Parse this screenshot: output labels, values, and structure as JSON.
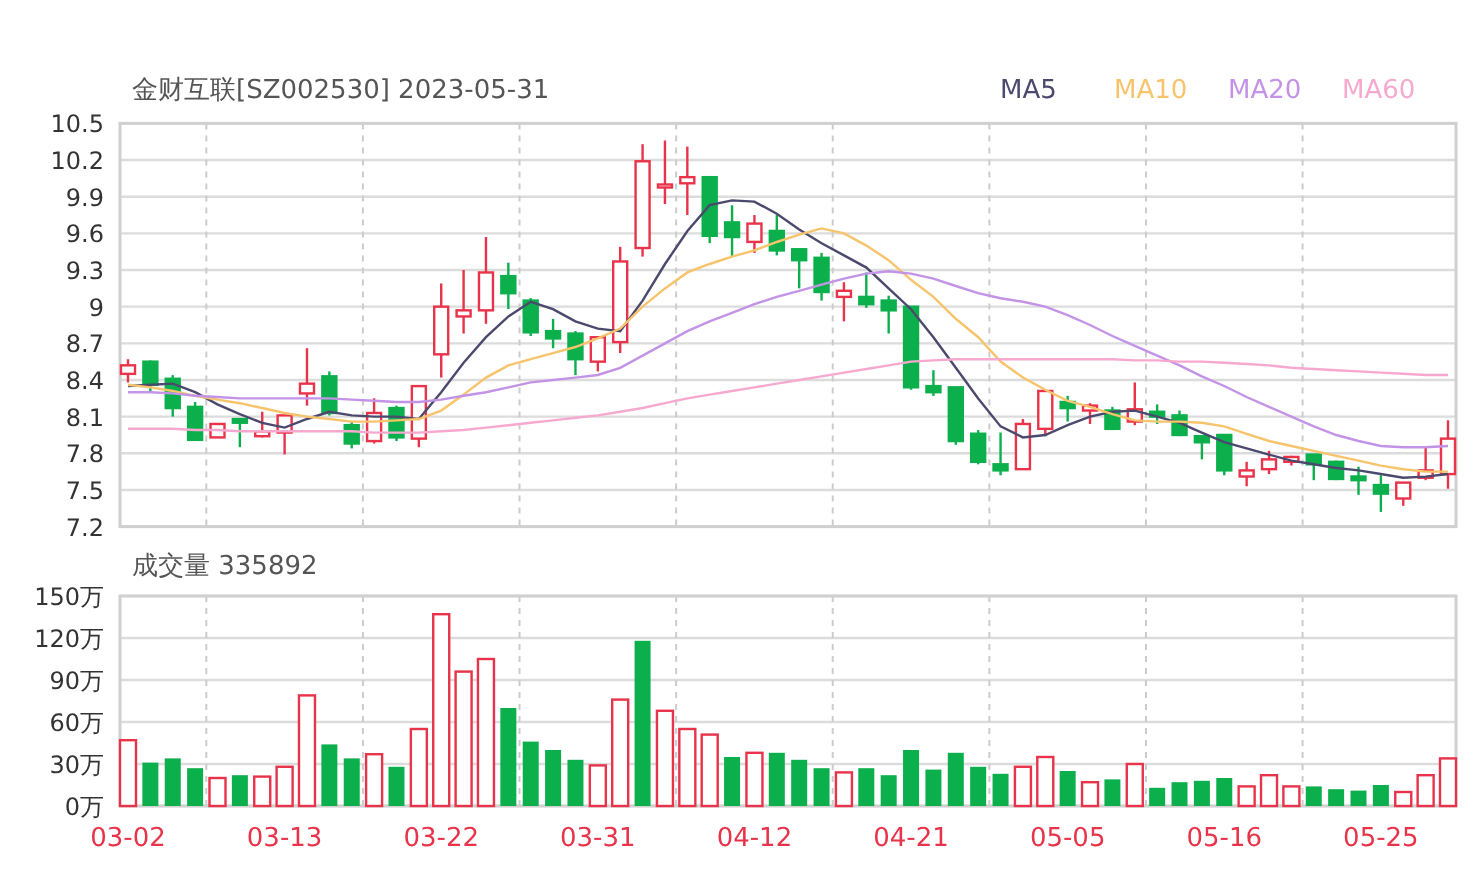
{
  "price_chart": {
    "chart_data": {
      "type": "candlestick",
      "title": "金财互联[SZ002530] 2023-05-31",
      "grid": true,
      "ylim": [
        7.2,
        10.5
      ],
      "yticks": [
        7.2,
        7.5,
        7.8,
        8.1,
        8.4,
        8.7,
        9,
        9.3,
        9.6,
        9.9,
        10.2,
        10.5
      ],
      "categories": [
        null,
        null,
        null,
        null,
        null,
        null,
        null,
        null,
        null,
        null,
        null,
        null,
        null,
        null,
        null,
        null,
        null,
        null,
        null,
        null,
        null,
        null,
        null,
        null,
        null,
        null,
        null,
        null,
        null,
        null,
        null,
        null,
        null,
        null,
        null,
        null,
        null,
        null,
        null,
        null,
        null,
        null,
        null,
        null,
        null,
        null,
        null,
        null,
        null,
        null,
        null,
        null,
        null,
        null,
        null,
        null,
        null,
        null,
        null,
        null
      ],
      "series": [
        {
          "name": "MA5",
          "type": "line",
          "color": "#4b4a6e",
          "values": [
            8.35,
            8.36,
            8.37,
            8.3,
            8.2,
            8.12,
            8.05,
            8.01,
            8.08,
            8.14,
            8.11,
            8.1,
            8.1,
            8.08,
            8.3,
            8.54,
            8.75,
            8.92,
            9.04,
            8.98,
            8.88,
            8.82,
            8.8,
            9.05,
            9.35,
            9.62,
            9.83,
            9.87,
            9.86,
            9.76,
            9.63,
            9.52,
            9.42,
            9.32,
            9.15,
            8.98,
            8.75,
            8.5,
            8.25,
            8.02,
            7.93,
            7.95,
            8.03,
            8.1,
            8.14,
            8.15,
            8.1,
            8.05,
            7.97,
            7.89,
            7.84,
            7.79,
            7.74,
            7.71,
            7.68,
            7.66,
            7.63,
            7.6,
            7.61,
            7.63
          ]
        },
        {
          "name": "MA10",
          "type": "line",
          "color": "#f7c36b",
          "values": [
            8.36,
            8.34,
            8.31,
            8.27,
            8.24,
            8.21,
            8.17,
            8.13,
            8.1,
            8.08,
            8.06,
            8.06,
            8.07,
            8.08,
            8.15,
            8.28,
            8.42,
            8.52,
            8.57,
            8.62,
            8.67,
            8.74,
            8.82,
            9.0,
            9.15,
            9.28,
            9.35,
            9.41,
            9.46,
            9.53,
            9.59,
            9.64,
            9.6,
            9.5,
            9.38,
            9.22,
            9.08,
            8.9,
            8.75,
            8.55,
            8.42,
            8.32,
            8.23,
            8.18,
            8.12,
            8.07,
            8.06,
            8.06,
            8.05,
            8.02,
            7.96,
            7.9,
            7.86,
            7.82,
            7.78,
            7.74,
            7.7,
            7.67,
            7.65,
            7.65
          ]
        },
        {
          "name": "MA20",
          "type": "line",
          "color": "#c293e6",
          "values": [
            8.3,
            8.3,
            8.29,
            8.27,
            8.26,
            8.25,
            8.25,
            8.25,
            8.25,
            8.25,
            8.24,
            8.23,
            8.22,
            8.22,
            8.24,
            8.27,
            8.3,
            8.34,
            8.38,
            8.4,
            8.42,
            8.44,
            8.5,
            8.6,
            8.7,
            8.8,
            8.88,
            8.95,
            9.02,
            9.08,
            9.13,
            9.18,
            9.23,
            9.27,
            9.29,
            9.27,
            9.23,
            9.17,
            9.11,
            9.07,
            9.04,
            9.0,
            8.93,
            8.85,
            8.76,
            8.68,
            8.6,
            8.52,
            8.43,
            8.35,
            8.26,
            8.18,
            8.1,
            8.02,
            7.95,
            7.9,
            7.86,
            7.85,
            7.85,
            7.86
          ]
        },
        {
          "name": "MA60",
          "type": "line",
          "color": "#f7a8cf",
          "values": [
            8.0,
            8.0,
            8.0,
            7.99,
            7.99,
            7.98,
            7.98,
            7.98,
            7.98,
            7.98,
            7.98,
            7.97,
            7.97,
            7.97,
            7.98,
            7.99,
            8.01,
            8.03,
            8.05,
            8.07,
            8.09,
            8.11,
            8.14,
            8.17,
            8.21,
            8.25,
            8.28,
            8.31,
            8.34,
            8.37,
            8.4,
            8.43,
            8.46,
            8.49,
            8.52,
            8.55,
            8.56,
            8.57,
            8.57,
            8.57,
            8.57,
            8.57,
            8.57,
            8.57,
            8.57,
            8.56,
            8.56,
            8.55,
            8.55,
            8.54,
            8.53,
            8.52,
            8.5,
            8.49,
            8.48,
            8.47,
            8.46,
            8.45,
            8.44,
            8.44
          ]
        }
      ],
      "ohlc": [
        [
          8.45,
          8.57,
          8.38,
          8.52
        ],
        [
          8.55,
          8.56,
          8.3,
          8.36
        ],
        [
          8.41,
          8.44,
          8.1,
          8.17
        ],
        [
          8.18,
          8.22,
          7.91,
          7.91
        ],
        [
          7.93,
          8.04,
          7.93,
          8.04
        ],
        [
          8.08,
          8.09,
          7.85,
          8.05
        ],
        [
          7.94,
          8.14,
          7.93,
          7.98
        ],
        [
          7.97,
          8.11,
          7.79,
          8.11
        ],
        [
          8.29,
          8.66,
          8.19,
          8.37
        ],
        [
          8.43,
          8.47,
          8.11,
          8.13
        ],
        [
          8.03,
          8.06,
          7.84,
          7.88
        ],
        [
          7.9,
          8.25,
          7.88,
          8.13
        ],
        [
          8.17,
          8.19,
          7.9,
          7.93
        ],
        [
          7.92,
          8.35,
          7.85,
          8.35
        ],
        [
          8.61,
          9.19,
          8.42,
          9.0
        ],
        [
          8.92,
          9.3,
          8.78,
          8.97
        ],
        [
          8.97,
          9.57,
          8.86,
          9.28
        ],
        [
          9.25,
          9.36,
          8.98,
          9.11
        ],
        [
          9.05,
          9.07,
          8.76,
          8.79
        ],
        [
          8.8,
          8.9,
          8.66,
          8.74
        ],
        [
          8.78,
          8.8,
          8.44,
          8.57
        ],
        [
          8.55,
          8.75,
          8.47,
          8.75
        ],
        [
          8.71,
          9.49,
          8.62,
          9.37
        ],
        [
          9.48,
          10.33,
          9.41,
          10.19
        ],
        [
          9.98,
          10.36,
          9.84,
          10.0
        ],
        [
          10.01,
          10.31,
          9.75,
          10.06
        ],
        [
          10.06,
          10.06,
          9.52,
          9.58
        ],
        [
          9.69,
          9.83,
          9.41,
          9.57
        ],
        [
          9.53,
          9.75,
          9.44,
          9.68
        ],
        [
          9.62,
          9.75,
          9.42,
          9.46
        ],
        [
          9.47,
          9.47,
          9.15,
          9.38
        ],
        [
          9.4,
          9.44,
          9.05,
          9.12
        ],
        [
          9.08,
          9.2,
          8.88,
          9.13
        ],
        [
          9.08,
          9.28,
          8.99,
          9.02
        ],
        [
          9.05,
          9.09,
          8.78,
          8.97
        ],
        [
          9.0,
          9.0,
          8.32,
          8.34
        ],
        [
          8.35,
          8.48,
          8.27,
          8.3
        ],
        [
          8.34,
          8.34,
          7.87,
          7.9
        ],
        [
          7.96,
          7.99,
          7.71,
          7.73
        ],
        [
          7.71,
          7.97,
          7.62,
          7.66
        ],
        [
          7.67,
          8.08,
          7.67,
          8.04
        ],
        [
          8.0,
          8.31,
          7.94,
          8.31
        ],
        [
          8.22,
          8.27,
          8.06,
          8.17
        ],
        [
          8.15,
          8.21,
          8.04,
          8.19
        ],
        [
          8.15,
          8.18,
          7.99,
          8.0
        ],
        [
          8.06,
          8.38,
          8.03,
          8.16
        ],
        [
          8.14,
          8.2,
          8.04,
          8.1
        ],
        [
          8.11,
          8.15,
          7.94,
          7.95
        ],
        [
          7.94,
          7.94,
          7.75,
          7.89
        ],
        [
          7.95,
          7.95,
          7.62,
          7.66
        ],
        [
          7.61,
          7.73,
          7.53,
          7.66
        ],
        [
          7.67,
          7.82,
          7.63,
          7.75
        ],
        [
          7.73,
          7.78,
          7.7,
          7.77
        ],
        [
          7.79,
          7.79,
          7.58,
          7.71
        ],
        [
          7.73,
          7.74,
          7.58,
          7.59
        ],
        [
          7.61,
          7.69,
          7.46,
          7.58
        ],
        [
          7.54,
          7.62,
          7.32,
          7.47
        ],
        [
          7.43,
          7.56,
          7.37,
          7.56
        ],
        [
          7.6,
          7.85,
          7.58,
          7.66
        ],
        [
          7.63,
          8.07,
          7.51,
          7.92
        ]
      ]
    }
  },
  "volume_chart": {
    "chart_data": {
      "type": "bar",
      "title": "成交量 335892",
      "grid": true,
      "ylim": [
        0,
        150
      ],
      "categories": [
        "03-02",
        null,
        null,
        null,
        null,
        null,
        null,
        "03-13",
        null,
        null,
        null,
        null,
        null,
        null,
        "03-22",
        null,
        null,
        null,
        null,
        null,
        null,
        "03-31",
        null,
        null,
        null,
        null,
        null,
        null,
        "04-12",
        null,
        null,
        null,
        null,
        null,
        null,
        "04-21",
        null,
        null,
        null,
        null,
        null,
        null,
        "05-05",
        null,
        null,
        null,
        null,
        null,
        null,
        "05-16",
        null,
        null,
        null,
        null,
        null,
        null,
        "05-25",
        null,
        null,
        null
      ],
      "yticks": [
        {
          "value": 0,
          "label": "0万"
        },
        {
          "value": 30,
          "label": "30万"
        },
        {
          "value": 60,
          "label": "60万"
        },
        {
          "value": 90,
          "label": "90万"
        },
        {
          "value": 120,
          "label": "120万"
        },
        {
          "value": 150,
          "label": "150万"
        }
      ],
      "series": [
        {
          "color": "#e8334a",
          "values": [
            47,
            null,
            null,
            null,
            20,
            null,
            21,
            28,
            79,
            null,
            null,
            37,
            null,
            55,
            137,
            96,
            105,
            null,
            null,
            null,
            null,
            29,
            76,
            null,
            68,
            55,
            51,
            null,
            38,
            null,
            null,
            null,
            24,
            null,
            null,
            null,
            null,
            null,
            null,
            null,
            28,
            35,
            null,
            17,
            null,
            30,
            null,
            null,
            null,
            null,
            14,
            22,
            14,
            null,
            null,
            null,
            null,
            10,
            22,
            34
          ]
        },
        {
          "color": "#0bb04d",
          "values": [
            null,
            31,
            34,
            27,
            null,
            22,
            null,
            null,
            null,
            44,
            34,
            null,
            28,
            null,
            null,
            null,
            null,
            70,
            46,
            40,
            33,
            null,
            null,
            118,
            null,
            null,
            null,
            35,
            null,
            38,
            33,
            27,
            null,
            27,
            22,
            40,
            26,
            38,
            28,
            23,
            null,
            null,
            25,
            null,
            19,
            null,
            13,
            17,
            18,
            20,
            null,
            null,
            null,
            14,
            12,
            11,
            15,
            null,
            null,
            null
          ]
        }
      ]
    }
  }
}
